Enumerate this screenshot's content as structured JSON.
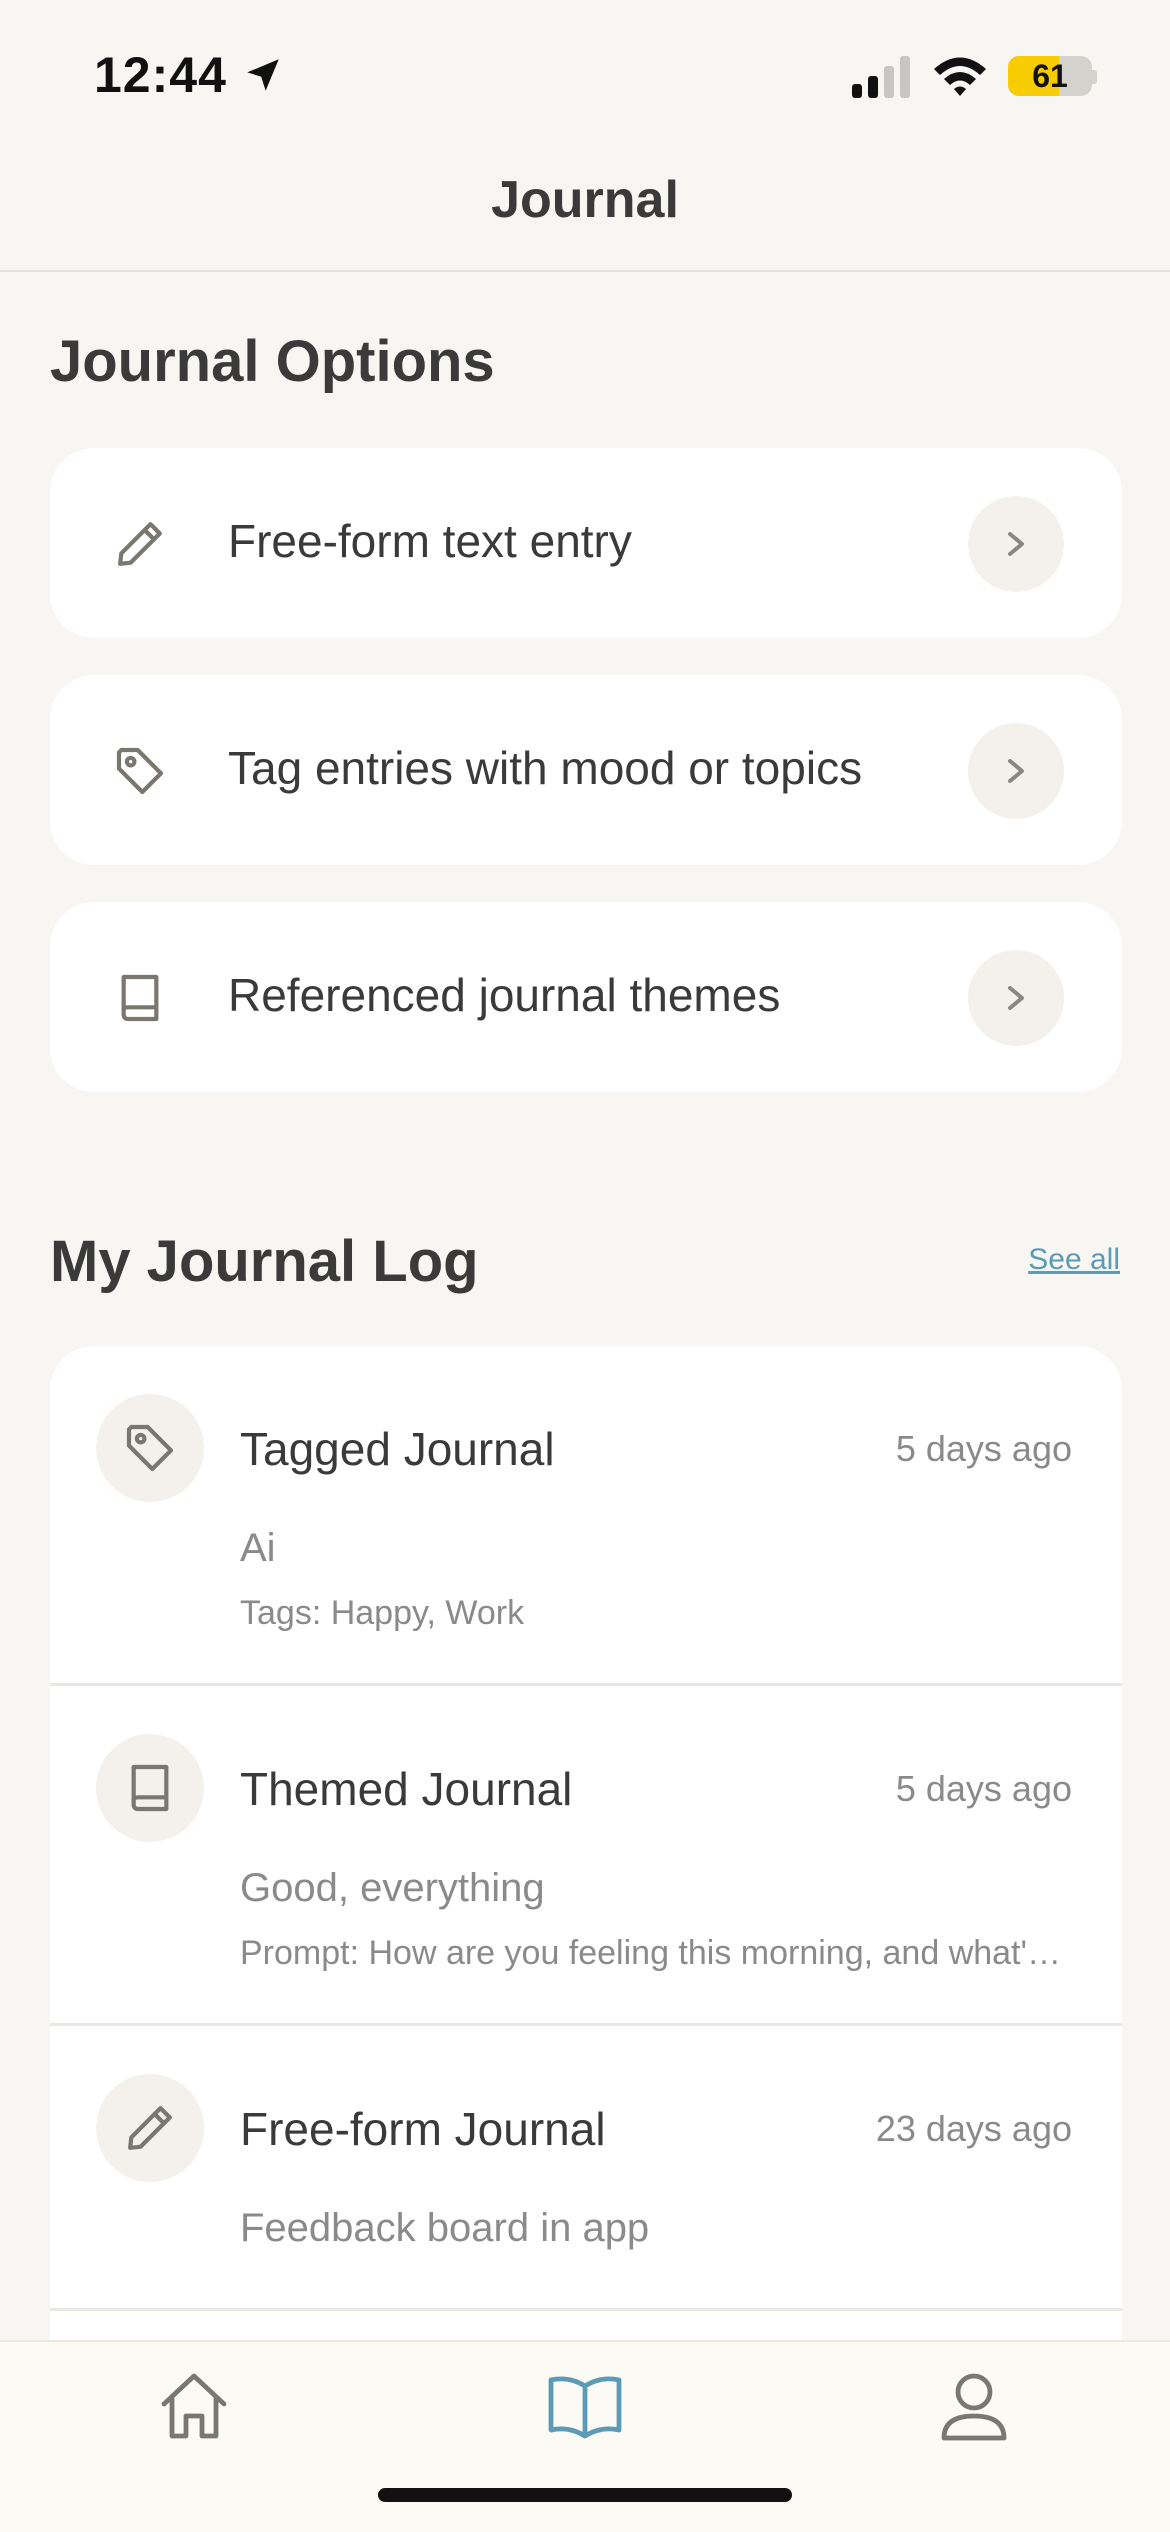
{
  "status_bar": {
    "time": "12:44",
    "battery": "61",
    "battery_color": "#f7cc00"
  },
  "header": {
    "title": "Journal"
  },
  "journal_options": {
    "title": "Journal Options",
    "items": [
      {
        "label": "Free-form text entry",
        "icon": "pencil-icon"
      },
      {
        "label": "Tag entries with mood or topics",
        "icon": "tag-icon"
      },
      {
        "label": "Referenced journal themes",
        "icon": "book-icon"
      }
    ]
  },
  "journal_log": {
    "title": "My Journal Log",
    "see_all": "See all",
    "entries": [
      {
        "title": "Tagged Journal",
        "date": "5 days ago",
        "line1": "Ai",
        "line2": "Tags: Happy, Work",
        "icon": "tag-icon"
      },
      {
        "title": "Themed Journal",
        "date": "5 days ago",
        "line1": "Good, everything",
        "line2": "Prompt: How are you feeling this morning, and what's on your mind?",
        "icon": "book-icon"
      },
      {
        "title": "Free-form Journal",
        "date": "23 days ago",
        "line1": "Feedback board in app",
        "line2": "",
        "icon": "pencil-icon"
      }
    ]
  },
  "tab_bar": {
    "tabs": [
      {
        "name": "home",
        "icon": "home-icon",
        "active": false
      },
      {
        "name": "journal",
        "icon": "open-book-icon",
        "active": true
      },
      {
        "name": "profile",
        "icon": "person-icon",
        "active": false
      }
    ],
    "active_color": "#5b9bb5"
  }
}
